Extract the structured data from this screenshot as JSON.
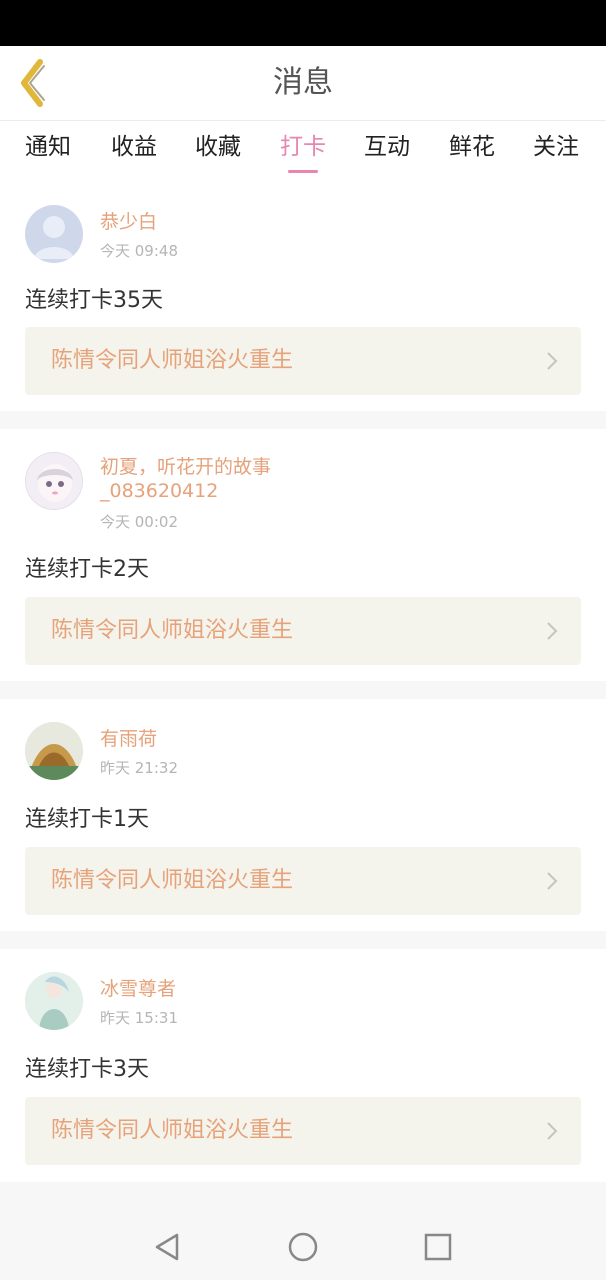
{
  "header": {
    "title": "消息"
  },
  "tabs": [
    {
      "label": "通知"
    },
    {
      "label": "收益"
    },
    {
      "label": "收藏"
    },
    {
      "label": "打卡",
      "active": true
    },
    {
      "label": "互动"
    },
    {
      "label": "鲜花"
    },
    {
      "label": "关注"
    }
  ],
  "messages": [
    {
      "user": "恭少白",
      "time": "今天 09:48",
      "text": "连续打卡35天",
      "group": "陈情令同人师姐浴火重生"
    },
    {
      "user": "初夏，听花开的故事\n_083620412",
      "time": "今天 00:02",
      "text": "连续打卡2天",
      "group": "陈情令同人师姐浴火重生"
    },
    {
      "user": "有雨荷",
      "time": "昨天 21:32",
      "text": "连续打卡1天",
      "group": "陈情令同人师姐浴火重生"
    },
    {
      "user": "冰雪尊者",
      "time": "昨天 15:31",
      "text": "连续打卡3天",
      "group": "陈情令同人师姐浴火重生"
    }
  ],
  "colors": {
    "accent": "#e786ae",
    "username": "#e6a27a",
    "group_bg": "#f4f4ec",
    "back_icon": "#e0b63b"
  },
  "icons": {
    "back": "chevron-left-icon",
    "chevron": "chevron-right-icon",
    "nav_back": "triangle-back-icon",
    "nav_home": "circle-home-icon",
    "nav_recent": "square-recent-icon"
  }
}
